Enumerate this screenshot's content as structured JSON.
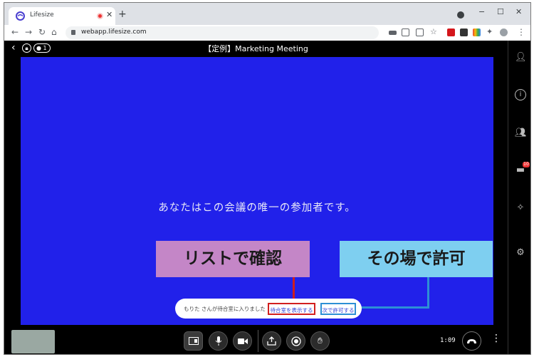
{
  "browser": {
    "tab_title": "Lifesize",
    "tab_close": "✕",
    "new_tab": "+",
    "minimize": "−",
    "maximize": "☐",
    "close": "✕",
    "url": "webapp.lifesize.com"
  },
  "meeting": {
    "title": "【定例】Marketing Meeting",
    "participant_count": "1",
    "alone_message": "あなたはこの会議の唯一の参加者です。",
    "timer": "1:09"
  },
  "notification": {
    "text": "もりた さんが待合室に入りました",
    "show_waiting_room": "待合室を表示する",
    "admit_next": "次で許可する"
  },
  "annotations": {
    "purple_label": "リストで確認",
    "blue_label": "その場で許可"
  },
  "sidebar": {
    "chat_badge": "10"
  },
  "colors": {
    "stage": "#2121ea",
    "annotation_purple": "#c486c7",
    "annotation_blue": "#7ecff0",
    "highlight_red": "#d21f1f",
    "highlight_blue": "#2d8fd5"
  }
}
